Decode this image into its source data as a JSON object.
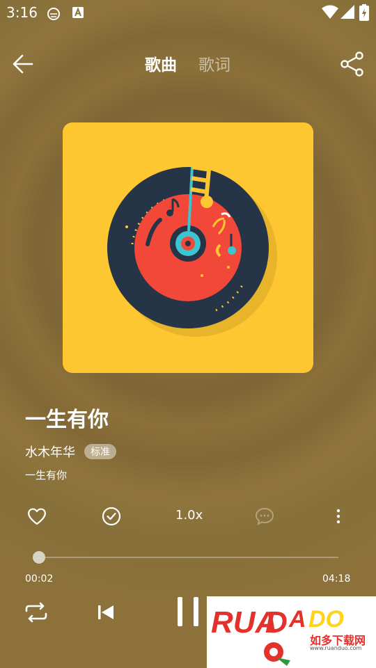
{
  "status_bar": {
    "time": "3:16",
    "icons": [
      "cat-notification-icon",
      "a-notification-icon",
      "wifi-icon",
      "signal-icon",
      "battery-icon"
    ]
  },
  "header": {
    "back_icon": "arrow-left-icon",
    "tabs": [
      {
        "label": "歌曲",
        "active": true
      },
      {
        "label": "歌词",
        "active": false
      }
    ],
    "share_icon": "share-icon"
  },
  "song": {
    "title": "一生有你",
    "artist": "水木年华",
    "quality": "标准",
    "album": "一生有你"
  },
  "actions": {
    "like_icon": "heart-icon",
    "download_icon": "check-circle-icon",
    "speed": "1.0x",
    "comment_icon": "comment-icon",
    "more_icon": "more-vertical-icon"
  },
  "progress": {
    "current": "00:02",
    "total": "04:18",
    "fraction": 0.008
  },
  "controls": {
    "repeat_icon": "repeat-icon",
    "prev_icon": "skip-previous-icon",
    "pause_icon": "pause-icon"
  },
  "watermark": {
    "logo_text": "RUANDUO",
    "caption": "如多下载网",
    "url": "www.ruanduo.com"
  },
  "colors": {
    "background": "#8a6f36",
    "album_bg": "#fec731",
    "vinyl": "#253446",
    "vinyl_label": "#f2483a",
    "accent_cyan": "#3cc4cf"
  }
}
